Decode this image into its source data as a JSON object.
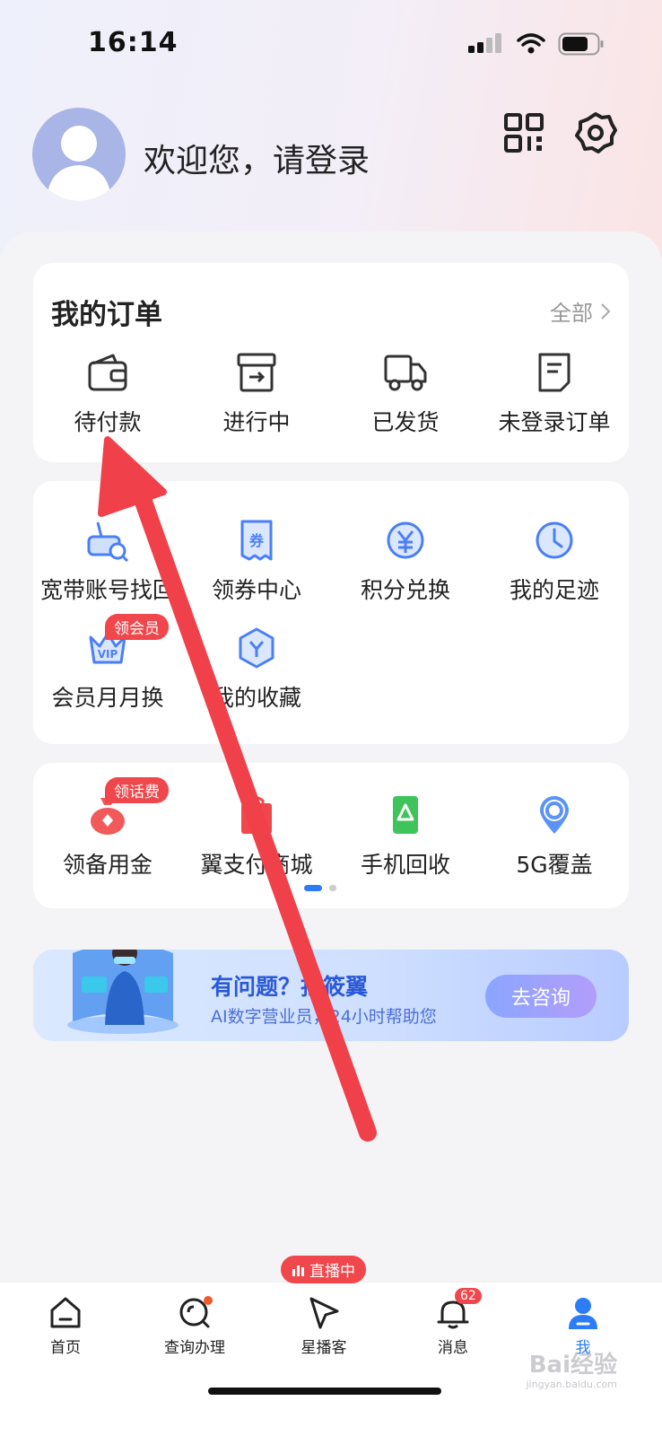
{
  "status": {
    "time": "16:14"
  },
  "header": {
    "welcome": "欢迎您，请登录"
  },
  "orders": {
    "title": "我的订单",
    "all_label": "全部",
    "items": [
      {
        "label": "待付款",
        "icon": "wallet-icon"
      },
      {
        "label": "进行中",
        "icon": "box-icon"
      },
      {
        "label": "已发货",
        "icon": "truck-icon"
      },
      {
        "label": "未登录订单",
        "icon": "document-icon"
      }
    ]
  },
  "services": {
    "items": [
      {
        "label": "宽带账号找回",
        "icon": "router-search-icon"
      },
      {
        "label": "领券中心",
        "icon": "coupon-icon"
      },
      {
        "label": "积分兑换",
        "icon": "yuan-exchange-icon"
      },
      {
        "label": "我的足迹",
        "icon": "clock-icon"
      },
      {
        "label": "会员月月换",
        "icon": "vip-crown-icon",
        "badge": "领会员"
      },
      {
        "label": "我的收藏",
        "icon": "favorite-hex-icon"
      }
    ]
  },
  "wallet": {
    "items": [
      {
        "label": "领备用金",
        "icon": "money-bag-icon",
        "badge": "领话费"
      },
      {
        "label": "翼支付商城",
        "icon": "shopping-bag-icon"
      },
      {
        "label": "手机回收",
        "icon": "phone-recycle-icon"
      },
      {
        "label": "5G覆盖",
        "icon": "location-signal-icon"
      }
    ]
  },
  "banner": {
    "title": "有问题？找筱翼",
    "subtitle": "AI数字营业员，24小时帮助您",
    "button": "去咨询"
  },
  "tabbar": {
    "live_badge": "直播中",
    "items": [
      {
        "label": "首页",
        "icon": "home-icon"
      },
      {
        "label": "查询办理",
        "icon": "search-icon"
      },
      {
        "label": "星播客",
        "icon": "play-icon"
      },
      {
        "label": "消息",
        "icon": "bell-icon",
        "badge": "62"
      },
      {
        "label": "我",
        "icon": "user-icon",
        "active": true
      }
    ]
  },
  "watermark": {
    "text": "Bai经验",
    "sub": "jingyan.baidu.com"
  },
  "colors": {
    "accent": "#2b7cf6",
    "badge": "#f0474c",
    "arrow": "#f0404a"
  }
}
